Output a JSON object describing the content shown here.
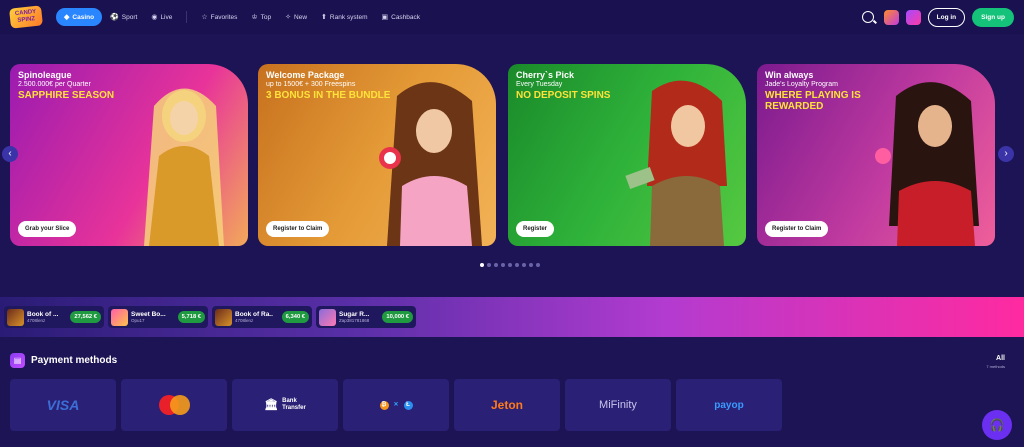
{
  "header": {
    "logo": "CANDY SPINZ",
    "nav": [
      {
        "label": "Casino",
        "icon": "diamond-icon"
      },
      {
        "label": "Sport",
        "icon": "ball-icon"
      },
      {
        "label": "Live",
        "icon": "live-icon"
      },
      {
        "label": "Favorites",
        "icon": "star-icon"
      },
      {
        "label": "Top",
        "icon": "trophy-icon"
      },
      {
        "label": "New",
        "icon": "sparkle-icon"
      },
      {
        "label": "Rank system",
        "icon": "rank-icon"
      },
      {
        "label": "Cashback",
        "icon": "cashback-icon"
      }
    ],
    "login": "Log in",
    "signup": "Sign up"
  },
  "banners": [
    {
      "title": "Spinoleague",
      "subtitle": "2.500.000€ per Quarter",
      "headline": "SAPPHIRE SEASON",
      "button": "Grab your Slice"
    },
    {
      "title": "Welcome Package",
      "subtitle": "up to 1500€ + 300 Freespins",
      "headline": "3 BONUS IN THE BUNDLE",
      "button": "Register to Claim"
    },
    {
      "title": "Cherry`s Pick",
      "subtitle": "Every Tuesday",
      "headline": "NO DEPOSIT SPINS",
      "button": "Register"
    },
    {
      "title": "Win always",
      "subtitle": "Jade's Loyalty Program",
      "headline": "WHERE PLAYING IS REWARDED",
      "button": "Register to Claim"
    }
  ],
  "slider": {
    "prev": "‹",
    "next": "›",
    "dots": 9,
    "active_dot": 0
  },
  "wins": [
    {
      "game": "Book of ...",
      "user": "4708lenz",
      "amount": "27,562 €"
    },
    {
      "game": "Sweet Bo...",
      "user": "Opu17",
      "amount": "5,718 €"
    },
    {
      "game": "Book of Ra...",
      "user": "4708lenz",
      "amount": "6,340 €"
    },
    {
      "game": "Sugar R...",
      "user": "Zap381781868",
      "amount": "10,000 €"
    }
  ],
  "payments": {
    "title": "Payment methods",
    "all": "All",
    "count": "7 methods",
    "methods": [
      "VISA",
      "Mastercard",
      "Bank Transfer",
      "Crypto",
      "Jeton",
      "MiFinity",
      "payop"
    ],
    "bank_line1": "Bank",
    "bank_line2": "Transfer"
  },
  "colors": {
    "accent": "#2a86ff",
    "success": "#15c27a",
    "bg": "#1c1454"
  }
}
